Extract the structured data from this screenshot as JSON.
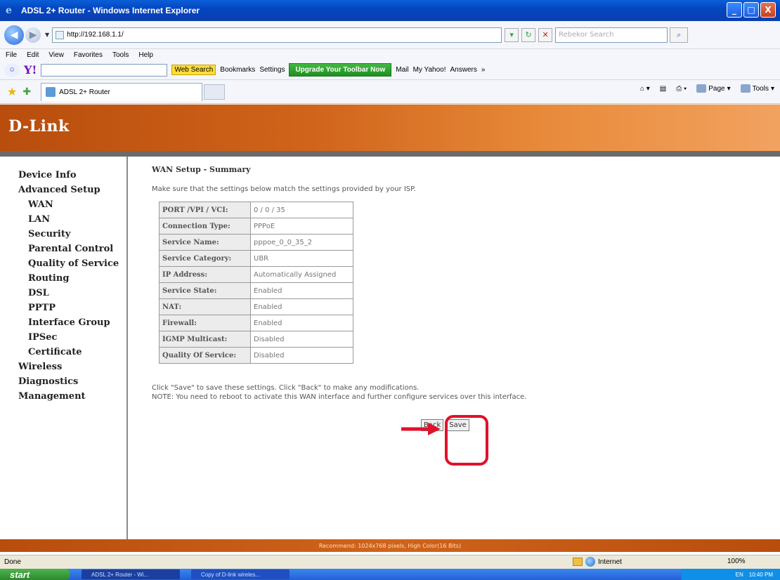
{
  "window": {
    "title": "ADSL 2+ Router - Windows Internet Explorer",
    "min": "_",
    "max": "□",
    "close": "X"
  },
  "addressbar": {
    "url": "http://192.168.1.1/",
    "search_placeholder": "Rebekor Search"
  },
  "menu": [
    "File",
    "Edit",
    "View",
    "Favorites",
    "Tools",
    "Help"
  ],
  "yahoo_toolbar": {
    "web_search": "Web Search",
    "bookmarks": "Bookmarks",
    "settings": "Settings",
    "upgrade": "Upgrade Your Toolbar Now",
    "mail": "Mail",
    "my_yahoo": "My Yahoo!",
    "answers": "Answers",
    "more": "»"
  },
  "tab": {
    "label": "ADSL 2+ Router"
  },
  "commandbar": {
    "page": "Page",
    "tools": "Tools"
  },
  "brand": {
    "logo": "D-Link",
    "accent": "#d0641a"
  },
  "nav": [
    {
      "label": "Device Info",
      "level": "top"
    },
    {
      "label": "Advanced Setup",
      "level": "top"
    },
    {
      "label": "WAN",
      "level": "sub"
    },
    {
      "label": "LAN",
      "level": "sub"
    },
    {
      "label": "Security",
      "level": "sub"
    },
    {
      "label": "Parental Control",
      "level": "sub"
    },
    {
      "label": "Quality of Service",
      "level": "sub"
    },
    {
      "label": "Routing",
      "level": "sub"
    },
    {
      "label": "DSL",
      "level": "sub"
    },
    {
      "label": "PPTP",
      "level": "sub"
    },
    {
      "label": "Interface Group",
      "level": "sub"
    },
    {
      "label": "IPSec",
      "level": "sub"
    },
    {
      "label": "Certificate",
      "level": "sub"
    },
    {
      "label": "Wireless",
      "level": "top"
    },
    {
      "label": "Diagnostics",
      "level": "top"
    },
    {
      "label": "Management",
      "level": "top"
    }
  ],
  "main": {
    "heading": "WAN Setup - Summary",
    "intro": "Make sure that the settings below match the settings provided by your ISP.",
    "rows": [
      {
        "key": "PORT /VPI / VCI:",
        "value": "0 / 0 / 35"
      },
      {
        "key": "Connection Type:",
        "value": "PPPoE"
      },
      {
        "key": "Service Name:",
        "value": "pppoe_0_0_35_2"
      },
      {
        "key": "Service Category:",
        "value": "UBR"
      },
      {
        "key": "IP Address:",
        "value": "Automatically Assigned"
      },
      {
        "key": "Service State:",
        "value": "Enabled"
      },
      {
        "key": "NAT:",
        "value": "Enabled"
      },
      {
        "key": "Firewall:",
        "value": "Enabled"
      },
      {
        "key": "IGMP Multicast:",
        "value": "Disabled"
      },
      {
        "key": "Quality Of Service:",
        "value": "Disabled"
      }
    ],
    "note1": "Click \"Save\" to save these settings. Click \"Back\" to make any modifications.",
    "note2": "NOTE: You need to reboot to activate this WAN interface and further configure services over this interface.",
    "back_label": "Back",
    "save_label": "Save"
  },
  "footer": "Recommend: 1024x768 pixels, High Color(16 Bits)",
  "statusbar": {
    "status": "Done",
    "zone": "Internet",
    "zoom": "100%"
  },
  "taskbar": {
    "start": "start",
    "task1": "ADSL 2+ Router - Wi...",
    "task2": "Copy of D-link wireles...",
    "lang": "EN",
    "time": "10:40 PM"
  }
}
